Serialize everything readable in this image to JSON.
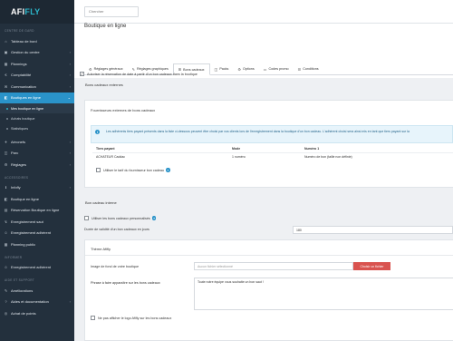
{
  "sidebar": {
    "logo_main": "AFI",
    "logo_accent": "FLY",
    "sections": [
      {
        "title": "CENTRE DE GARD"
      },
      {
        "title": "ACCESSOIRES"
      },
      {
        "title": "INFORMER"
      },
      {
        "title": "AIDE ET SUPPORT"
      }
    ],
    "items": [
      {
        "label": "Tableau de bord",
        "icon": "⌂"
      },
      {
        "label": "Gestion du centre",
        "icon": "▣"
      },
      {
        "label": "Plannings",
        "icon": "▦"
      },
      {
        "label": "Comptabilité",
        "icon": "€"
      },
      {
        "label": "Communication",
        "icon": "✉"
      },
      {
        "label": "Boutiques en ligne",
        "icon": "◧"
      },
      {
        "label": "Mes boutique en ligne"
      },
      {
        "label": "Achats boutique"
      },
      {
        "label": "Statistiques"
      },
      {
        "label": "Aéronefs",
        "icon": "✈"
      },
      {
        "label": "Parc",
        "icon": "◫"
      },
      {
        "label": "Réglages",
        "icon": "⚙"
      },
      {
        "label": "Infofly",
        "icon": "ℹ"
      },
      {
        "label": "Boutique en ligne",
        "icon": "◧"
      },
      {
        "label": "Réservation Boutique en ligne",
        "icon": "▤"
      },
      {
        "label": "Enregistrement saut",
        "icon": "↯"
      },
      {
        "label": "Enregistrement adhérent",
        "icon": "☺"
      },
      {
        "label": "Planning public",
        "icon": "▦"
      },
      {
        "label": "Enregistrement adhérent",
        "icon": "☺"
      },
      {
        "label": "Améliorations",
        "icon": "✎"
      },
      {
        "label": "Aides et documentation",
        "icon": "?"
      },
      {
        "label": "Achat de points",
        "icon": "◎"
      }
    ]
  },
  "topbar": {
    "search_placeholder": "Chercher"
  },
  "page": {
    "title": "Boutique en ligne"
  },
  "tabs": [
    {
      "label": "Réglages généraux",
      "icon": "⚙"
    },
    {
      "label": "Réglages graphiques",
      "icon": "✎"
    },
    {
      "label": "Bons cadeaux",
      "icon": "⊞"
    },
    {
      "label": "Packs",
      "icon": "◫"
    },
    {
      "label": "Options",
      "icon": "⚙"
    },
    {
      "label": "Codes promo",
      "icon": "▭"
    },
    {
      "label": "Conditions",
      "icon": "☰"
    }
  ],
  "content": {
    "authorize_label": "Autoriser la réservation de date à partir d'un bon cadeaux dans la boutique",
    "external_title": "Bons cadeaux externes",
    "providers_title": "Fournisseurs externes de bons cadeaux",
    "info_text": "Les adhérents tiers payant présents dans la liste ci-dessous peuvent être choisi par vos clients lors de l'enregistrement dans la boutique d'un bon cadeau. L'adhérent choisi sera ainsi mis en tant que tiers payant sur la",
    "table": {
      "headers": [
        "Tiers payant",
        "Mode",
        "Numéro 1"
      ],
      "rows": [
        [
          "ACHATEUR Caddac",
          "1 numéro",
          "Numéro de bon (taille non définie)"
        ]
      ]
    },
    "use_tariff_label": "Utiliser le tarif du fournisseur bon cadeau",
    "internal_title": "Bon cadeau interne",
    "personalize_label": "Utiliser les bons cadeaux personnalisés",
    "validity_label": "Durée de validité d'un bon cadeaux en jours",
    "validity_value": "180",
    "theme_title": "Thème Afifly",
    "bg_label": "Image de fond de votre boutique",
    "file_placeholder": "Aucun fichier sélectionné",
    "file_button": "Choisir un fichier",
    "phrase_label": "Phrase à faire apparaître sur les bons cadeaux",
    "phrase_value": "Toute notre équipe vous souhaite un bon saut !",
    "no_logo_label": "Ne pas afficher le logo Afifly sur les bons cadeaux"
  },
  "colors": {
    "sidebar": "#23303d",
    "accent": "#2a93c9",
    "danger": "#d9534f"
  }
}
